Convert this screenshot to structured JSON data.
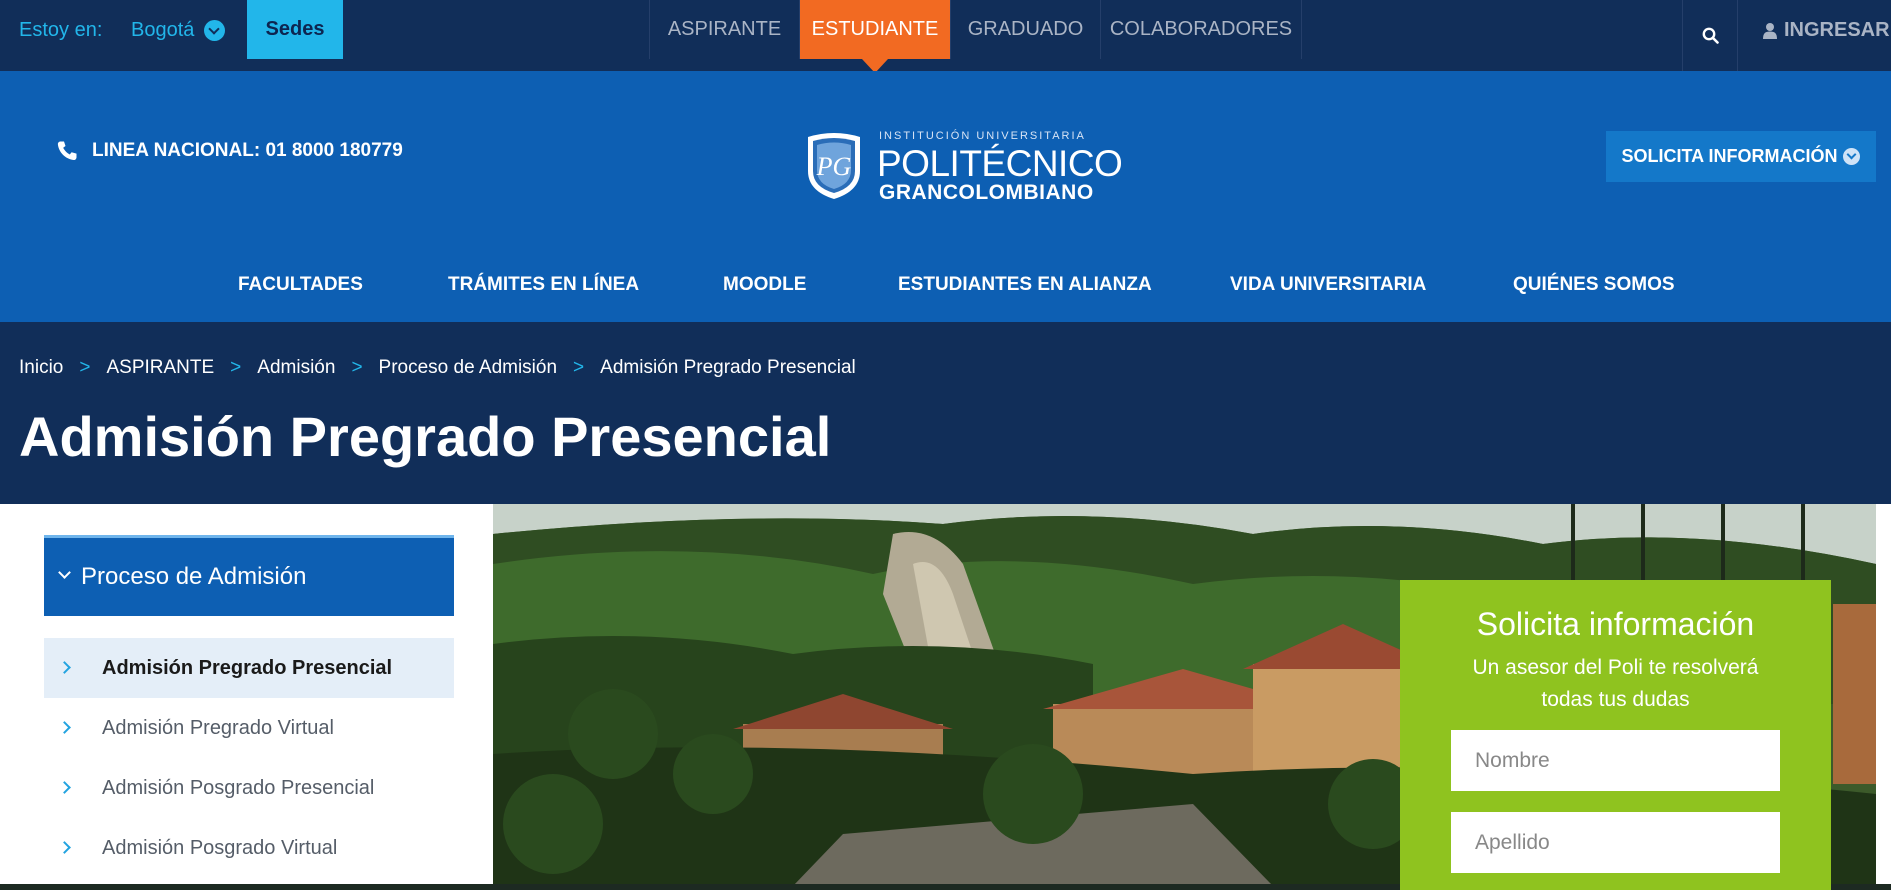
{
  "topbar": {
    "location_label": "Estoy en:",
    "city": "Bogotá",
    "sedes": "Sedes",
    "tabs": [
      "ASPIRANTE",
      "ESTUDIANTE",
      "GRADUADO",
      "COLABORADORES"
    ],
    "active_tab": "ESTUDIANTE",
    "login": "INGRESAR"
  },
  "header": {
    "phone": "LINEA NACIONAL: 01 8000 180779",
    "logo": {
      "small": "INSTITUCIÓN UNIVERSITARIA",
      "name": "POLITÉCNICO",
      "sub": "GRANCOLOMBIANO",
      "monogram": "PG"
    },
    "request_button": "SOLICITA INFORMACIÓN"
  },
  "mainnav": [
    "FACULTADES",
    "TRÁMITES EN LÍNEA",
    "MOODLE",
    "ESTUDIANTES EN ALIANZA",
    "VIDA UNIVERSITARIA",
    "QUIÉNES SOMOS"
  ],
  "breadcrumb": [
    "Inicio",
    "ASPIRANTE",
    "Admisión",
    "Proceso de Admisión",
    "Admisión Pregrado Presencial"
  ],
  "breadcrumb_separator": ">",
  "page_title": "Admisión Pregrado Presencial",
  "sidebar": {
    "title": "Proceso de Admisión",
    "items": [
      "Admisión Pregrado Presencial",
      "Admisión Pregrado Virtual",
      "Admisión Posgrado Presencial",
      "Admisión Posgrado Virtual"
    ],
    "active_index": 0
  },
  "form": {
    "title": "Solicita información",
    "subtitle": "Un asesor del Poli te resolverá todas tus dudas",
    "fields": [
      {
        "placeholder": "Nombre",
        "value": ""
      },
      {
        "placeholder": "Apellido",
        "value": ""
      }
    ]
  },
  "colors": {
    "topbar": "#112e59",
    "header": "#0d5fb3",
    "accent_cyan": "#22b6ea",
    "active_tab": "#f26a22",
    "form_green": "#8fc31f"
  },
  "icons": [
    "chevron-down-icon",
    "search-icon",
    "user-icon",
    "phone-icon",
    "chevron-right-icon"
  ]
}
